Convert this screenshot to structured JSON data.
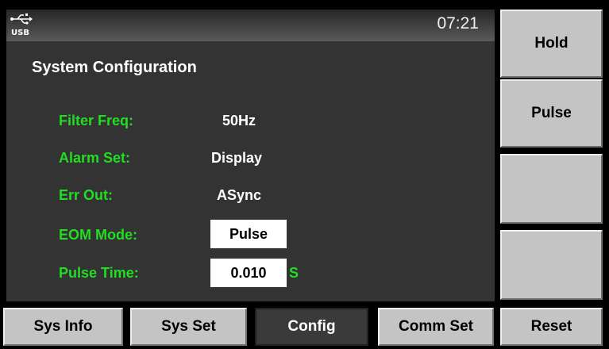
{
  "status": {
    "usb_icon_label": "USB",
    "time": "07:21"
  },
  "screen_title": "System Configuration",
  "settings": [
    {
      "label": "Filter Freq:",
      "value": "50Hz"
    },
    {
      "label": "Alarm Set:",
      "value": "Display"
    },
    {
      "label": "Err Out:",
      "value": "ASync"
    },
    {
      "label": "EOM Mode:",
      "value": "Pulse"
    },
    {
      "label": "Pulse Time:",
      "value": "0.010",
      "unit": "S"
    }
  ],
  "softkeys": [
    "Hold",
    "Pulse",
    "",
    ""
  ],
  "tabs": [
    "Sys Info",
    "Sys Set",
    "Config",
    "Comm Set"
  ],
  "reset_label": "Reset",
  "active_tab": "Config",
  "colors": {
    "label_green": "#22dd22",
    "panel": "#333333",
    "button_gray": "#c4c4c4"
  }
}
